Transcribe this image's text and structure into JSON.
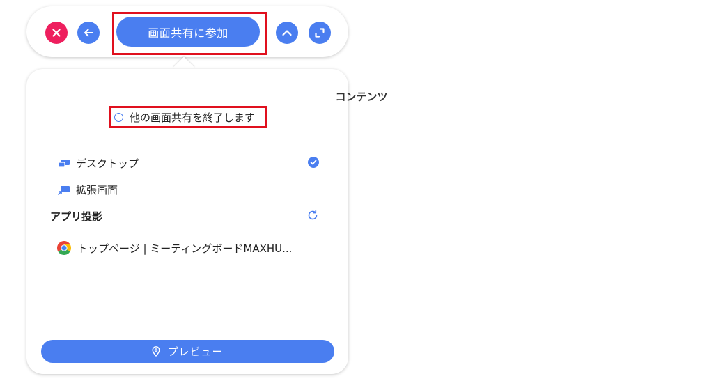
{
  "toolbar": {
    "join_label": "画面共有に参加",
    "icons": [
      "close-icon",
      "arrow-left-icon",
      "chevron-up-icon",
      "expand-icon"
    ]
  },
  "panel": {
    "section_title": "コンテンツ",
    "end_share_label": "他の画面共有を終了します",
    "items": [
      {
        "label": "デスクトップ",
        "icon": "desktop-icon",
        "selected": true
      },
      {
        "label": "拡張画面",
        "icon": "extended-screen-icon",
        "selected": false
      }
    ],
    "app_projection": {
      "title": "アプリ投影",
      "apps": [
        {
          "label": "トップページ | ミーティングボードMAXHU...",
          "icon": "chrome-icon"
        }
      ]
    },
    "preview_label": "プレビュー"
  },
  "colors": {
    "accent": "#4a7ef0",
    "close": "#ee1f5e",
    "highlight": "#e0101e"
  }
}
